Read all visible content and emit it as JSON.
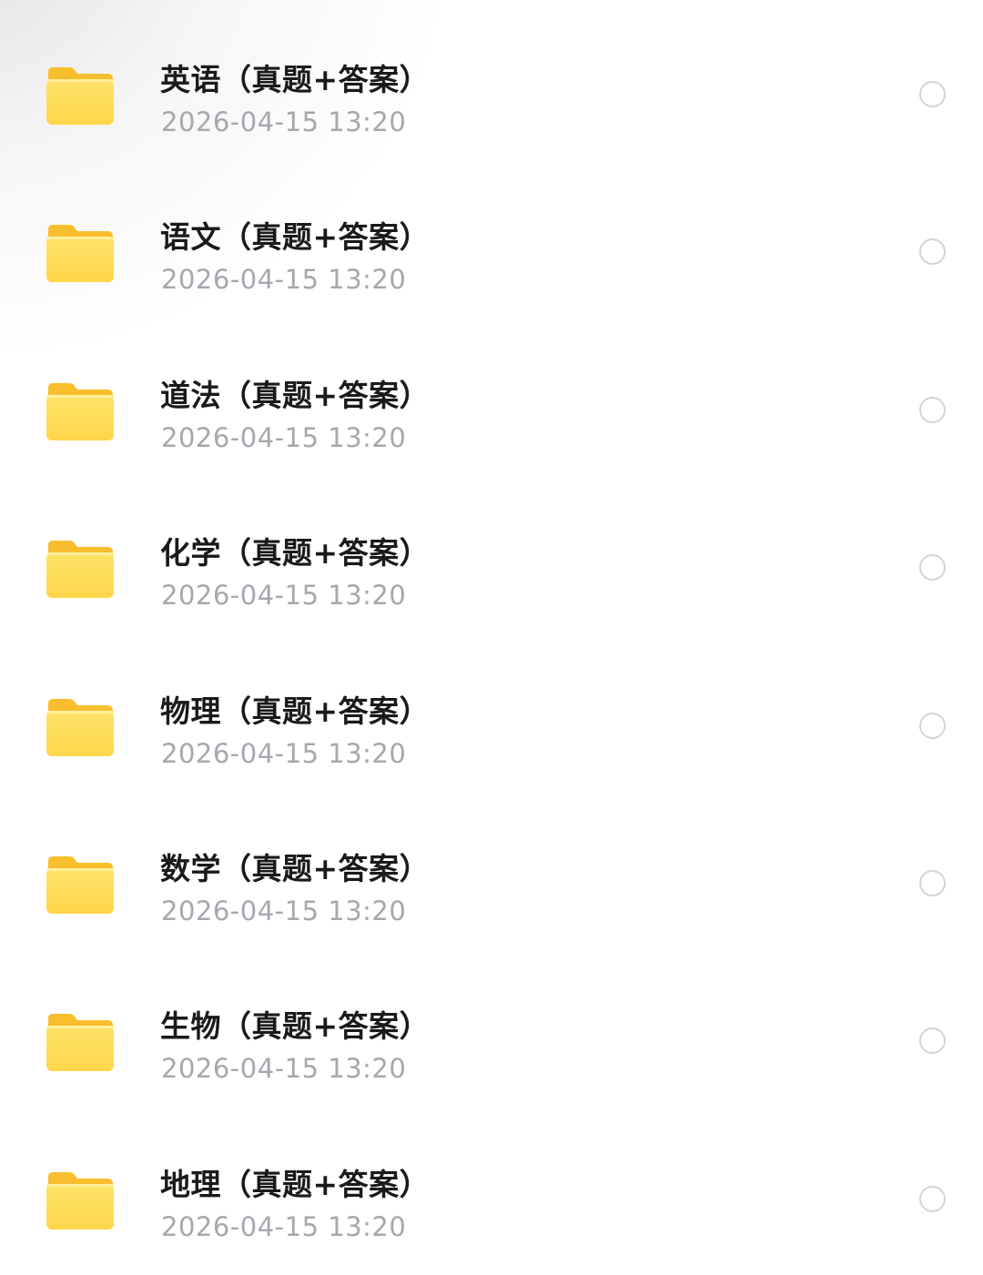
{
  "folder_list": {
    "items": [
      {
        "name": "英语（真题+答案）",
        "date": "2026-04-15 13:20",
        "selected": false
      },
      {
        "name": "语文（真题+答案）",
        "date": "2026-04-15 13:20",
        "selected": false
      },
      {
        "name": "道法（真题+答案）",
        "date": "2026-04-15 13:20",
        "selected": false
      },
      {
        "name": "化学（真题+答案）",
        "date": "2026-04-15 13:20",
        "selected": false
      },
      {
        "name": "物理（真题+答案）",
        "date": "2026-04-15 13:20",
        "selected": false
      },
      {
        "name": "数学（真题+答案）",
        "date": "2026-04-15 13:20",
        "selected": false
      },
      {
        "name": "生物（真题+答案）",
        "date": "2026-04-15 13:20",
        "selected": false
      },
      {
        "name": "地理（真题+答案）",
        "date": "2026-04-15 13:20",
        "selected": false
      }
    ],
    "icon": "folder-icon",
    "colors": {
      "folder_front": "#FFD64A",
      "folder_back": "#F8BE2E",
      "title_text": "#1a1a1a",
      "date_text": "#a5a8ae",
      "radio_border": "#d3d4d8"
    }
  }
}
